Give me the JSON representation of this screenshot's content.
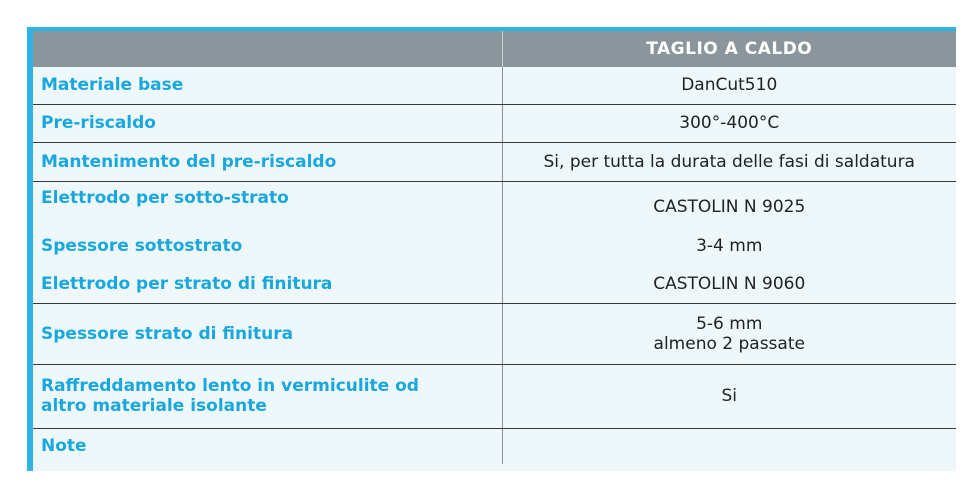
{
  "table": {
    "header": {
      "col1": "",
      "col2": "TAGLIO A CALDO"
    },
    "rows": [
      {
        "label": "Materiale base",
        "value": "DanCut510"
      },
      {
        "label": "Pre-riscaldo",
        "value": "300°-400°C"
      },
      {
        "label": "Mantenimento del pre-riscaldo",
        "value": "Si, per tutta la durata delle fasi di saldatura"
      },
      {
        "label": "Elettrodo per sotto-strato",
        "value": "CASTOLIN N 9025"
      },
      {
        "label": "Spessore sottostrato",
        "value": "3-4 mm"
      },
      {
        "label": "Elettrodo per strato di finitura",
        "value": "CASTOLIN N 9060"
      },
      {
        "label": "Spessore strato di finitura",
        "value_line1": "5-6 mm",
        "value_line2": "almeno 2 passate"
      },
      {
        "label_line1": "Raffreddamento lento in vermiculite od",
        "label_line2": "altro materiale isolante",
        "value": "Si"
      },
      {
        "label": "Note",
        "value": ""
      }
    ]
  },
  "colors": {
    "accent": "#2fb4e6",
    "header_bg": "#8b969c",
    "row_bg": "#eef8fb",
    "label_text": "#1aa7de"
  }
}
